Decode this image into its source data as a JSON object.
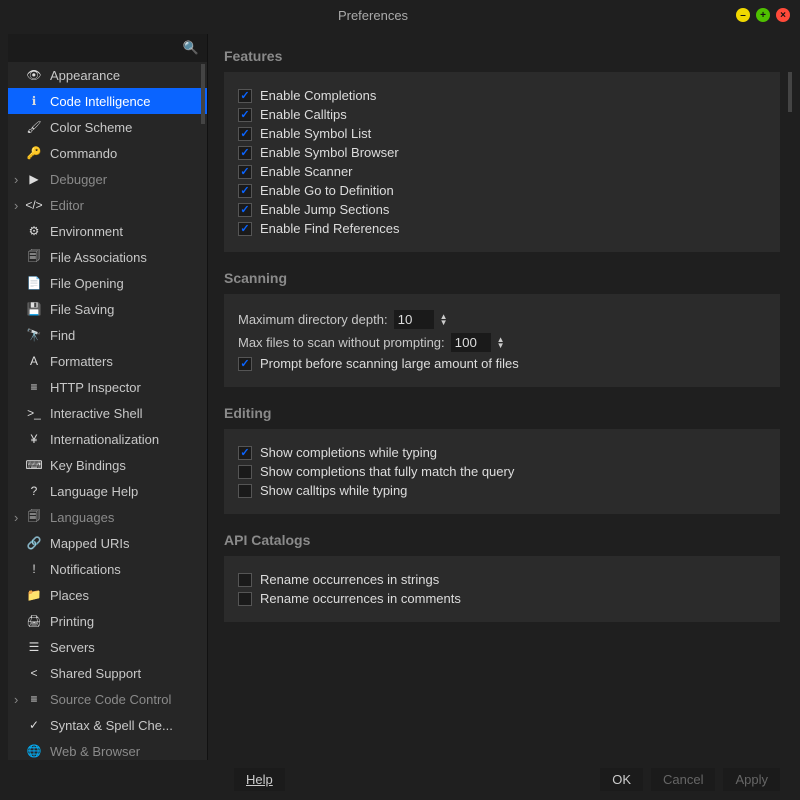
{
  "window": {
    "title": "Preferences"
  },
  "sidebar": {
    "items": [
      {
        "icon": "eye",
        "label": "Appearance",
        "sel": false
      },
      {
        "icon": "info",
        "label": "Code Intelligence",
        "sel": true
      },
      {
        "icon": "brush",
        "label": "Color Scheme",
        "sel": false
      },
      {
        "icon": "key",
        "label": "Commando",
        "sel": false
      },
      {
        "icon": "play",
        "label": "Debugger",
        "sel": false,
        "exp": true,
        "dim": true
      },
      {
        "icon": "code",
        "label": "Editor",
        "sel": false,
        "exp": true,
        "dim": true
      },
      {
        "icon": "gear",
        "label": "Environment",
        "sel": false
      },
      {
        "icon": "files",
        "label": "File Associations",
        "sel": false
      },
      {
        "icon": "doc",
        "label": "File Opening",
        "sel": false
      },
      {
        "icon": "save",
        "label": "File Saving",
        "sel": false
      },
      {
        "icon": "binoc",
        "label": "Find",
        "sel": false
      },
      {
        "icon": "A",
        "label": "Formatters",
        "sel": false
      },
      {
        "icon": "http",
        "label": "HTTP Inspector",
        "sel": false
      },
      {
        "icon": "term",
        "label": "Interactive Shell",
        "sel": false
      },
      {
        "icon": "yen",
        "label": "Internationalization",
        "sel": false
      },
      {
        "icon": "kb",
        "label": "Key Bindings",
        "sel": false
      },
      {
        "icon": "help",
        "label": "Language Help",
        "sel": false
      },
      {
        "icon": "lang",
        "label": "Languages",
        "sel": false,
        "exp": true,
        "dim": true
      },
      {
        "icon": "link",
        "label": "Mapped URIs",
        "sel": false
      },
      {
        "icon": "alert",
        "label": "Notifications",
        "sel": false
      },
      {
        "icon": "folder",
        "label": "Places",
        "sel": false
      },
      {
        "icon": "print",
        "label": "Printing",
        "sel": false
      },
      {
        "icon": "srv",
        "label": "Servers",
        "sel": false
      },
      {
        "icon": "share",
        "label": "Shared Support",
        "sel": false
      },
      {
        "icon": "db",
        "label": "Source Code Control",
        "sel": false,
        "exp": true,
        "dim": true
      },
      {
        "icon": "check",
        "label": "Syntax & Spell Che...",
        "sel": false
      },
      {
        "icon": "globe",
        "label": "Web & Browser",
        "sel": false,
        "dim": true
      }
    ]
  },
  "sections": {
    "features": {
      "title": "Features",
      "items": [
        {
          "label": "Enable Completions",
          "checked": true
        },
        {
          "label": "Enable Calltips",
          "checked": true
        },
        {
          "label": "Enable Symbol List",
          "checked": true
        },
        {
          "label": "Enable Symbol Browser",
          "checked": true
        },
        {
          "label": "Enable Scanner",
          "checked": true
        },
        {
          "label": "Enable Go to Definition",
          "checked": true
        },
        {
          "label": "Enable Jump Sections",
          "checked": true
        },
        {
          "label": "Enable Find References",
          "checked": true
        }
      ]
    },
    "scanning": {
      "title": "Scanning",
      "max_depth_label": "Maximum directory depth:",
      "max_depth": "10",
      "max_files_label": "Max files to scan without prompting:",
      "max_files": "100",
      "prompt_label": "Prompt before scanning large amount of files",
      "prompt_checked": true
    },
    "editing": {
      "title": "Editing",
      "items": [
        {
          "label": "Show completions while typing",
          "checked": true
        },
        {
          "label": "Show completions that fully match the query",
          "checked": false
        },
        {
          "label": "Show calltips while typing",
          "checked": false
        }
      ]
    },
    "api": {
      "title": "API Catalogs",
      "items": [
        {
          "label": "Rename occurrences in strings",
          "checked": false
        },
        {
          "label": "Rename occurrences in comments",
          "checked": false
        }
      ]
    }
  },
  "footer": {
    "help": "Help",
    "ok": "OK",
    "cancel": "Cancel",
    "apply": "Apply"
  },
  "iconmap": {
    "eye": "👁",
    "info": "ℹ",
    "brush": "🖌",
    "key": "🔑",
    "play": "▶",
    "code": "</>",
    "gear": "⚙",
    "files": "🗐",
    "doc": "📄",
    "save": "💾",
    "binoc": "🔭",
    "A": "A",
    "http": "≡",
    "term": ">_",
    "yen": "¥",
    "kb": "⌨",
    "help": "?",
    "lang": "🗐",
    "link": "🔗",
    "alert": "!",
    "folder": "📁",
    "print": "🖨",
    "srv": "☰",
    "share": "<",
    "db": "≡",
    "check": "✓",
    "globe": "🌐"
  }
}
